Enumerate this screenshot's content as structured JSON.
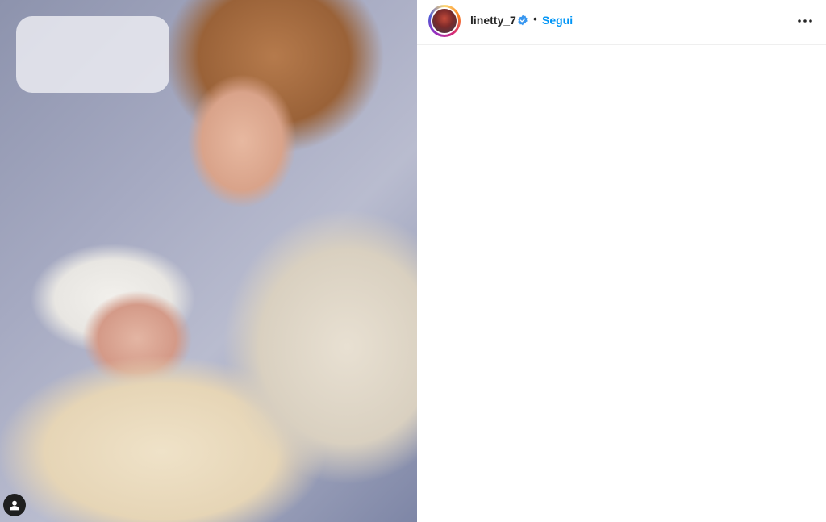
{
  "post": {
    "image_alt": "",
    "author_badge_icon": "user-icon"
  },
  "header": {
    "username": "linetty_7",
    "verified_icon": "verified-badge-icon",
    "separator": "•",
    "follow_label": "Segui",
    "more_icon": "more-options-icon"
  },
  "colors": {
    "link": "#0095f6",
    "text": "#262626",
    "badge": "#3897f0"
  }
}
